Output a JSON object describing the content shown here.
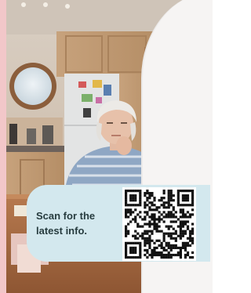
{
  "info_card": {
    "message": "Scan for the latest info.",
    "qr_icon": "qr-code-icon"
  },
  "colors": {
    "side_strip": "#f2c7c9",
    "card_background": "#d3e8ee",
    "card_text": "#273c3f",
    "arch_wall": "#f6f4f3"
  }
}
